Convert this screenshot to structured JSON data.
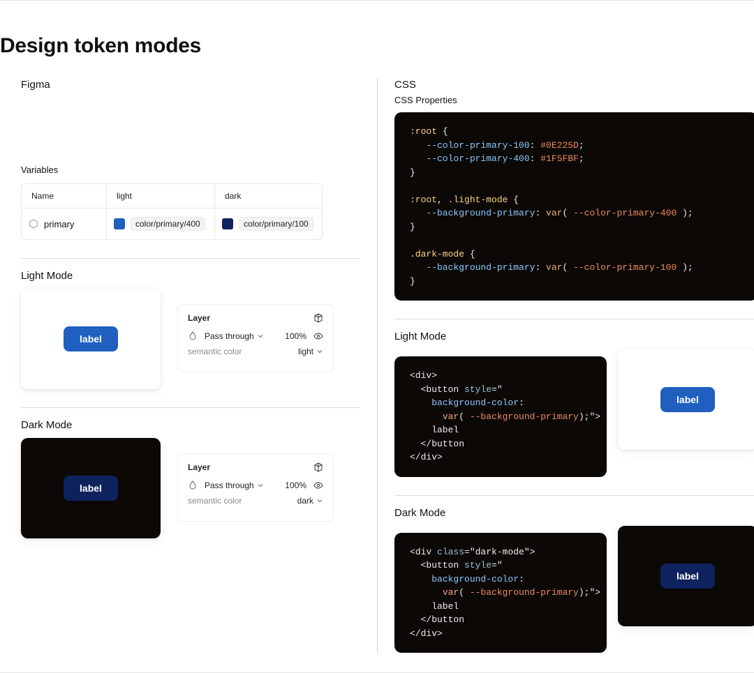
{
  "title": "Design token modes",
  "left": {
    "heading": "Figma",
    "variables_label": "Variables",
    "table": {
      "headers": {
        "name": "Name",
        "light": "light",
        "dark": "dark"
      },
      "row": {
        "name": "primary",
        "light_swatch": "#1F5FBF",
        "light_chip": "color/primary/400",
        "dark_swatch": "#0E225D",
        "dark_chip": "color/primary/100"
      }
    },
    "light": {
      "heading": "Light Mode",
      "button_label": "label",
      "panel": {
        "title": "Layer",
        "blend": "Pass through",
        "opacity": "100%",
        "semantic_label": "semantic color",
        "semantic_value": "light"
      }
    },
    "dark": {
      "heading": "Dark Mode",
      "button_label": "label",
      "panel": {
        "title": "Layer",
        "blend": "Pass through",
        "opacity": "100%",
        "semantic_label": "semantic color",
        "semantic_value": "dark"
      }
    }
  },
  "right": {
    "heading": "CSS",
    "properties_label": "CSS Properties",
    "code_root": {
      "l1a": ":root",
      "l1b": " {",
      "l2a": "--color-primary-100",
      "l2b": ": ",
      "l2c": "#0E225D",
      "l2d": ";",
      "l3a": "--color-primary-400",
      "l3b": ": ",
      "l3c": "#1F5FBF",
      "l3d": ";",
      "l4": "}",
      "l5a": ":root",
      "l5b": ", ",
      "l5c": ".light-mode",
      "l5d": " {",
      "l6a": "--background-primary",
      "l6b": ": ",
      "l6c": "var",
      "l6d": "( ",
      "l6e": "--color-primary-400",
      "l6f": " );",
      "l7": "}",
      "l8a": ".dark-mode",
      "l8b": " {",
      "l9a": "--background-primary",
      "l9b": ": ",
      "l9c": "var",
      "l9d": "( ",
      "l9e": "--color-primary-100",
      "l9f": " );",
      "l10": "}"
    },
    "light": {
      "heading": "Light Mode",
      "button_label": "label",
      "code": {
        "l1": "<div>",
        "l2a": "  <button ",
        "l2b": "style",
        "l2c": "=\"",
        "l3a": "    ",
        "l3b": "background-color",
        "l3c": ":",
        "l4a": "      ",
        "l4b": "var",
        "l4c": "( ",
        "l4d": "--background-primary",
        "l4e": ")",
        "l4f": ";\">",
        "l5": "    label",
        "l6": "  </button",
        "l7": "</div>"
      }
    },
    "dark": {
      "heading": "Dark Mode",
      "button_label": "label",
      "code": {
        "l1a": "<div ",
        "l1b": "class",
        "l1c": "=\"dark-mode\">",
        "l2a": "  <button ",
        "l2b": "style",
        "l2c": "=\"",
        "l3a": "    ",
        "l3b": "background-color",
        "l3c": ":",
        "l4a": "      ",
        "l4b": "var",
        "l4c": "( ",
        "l4d": "--background-primary",
        "l4e": ")",
        "l4f": ";\">",
        "l5": "    label",
        "l6": "  </button",
        "l7": "</div>"
      }
    }
  }
}
